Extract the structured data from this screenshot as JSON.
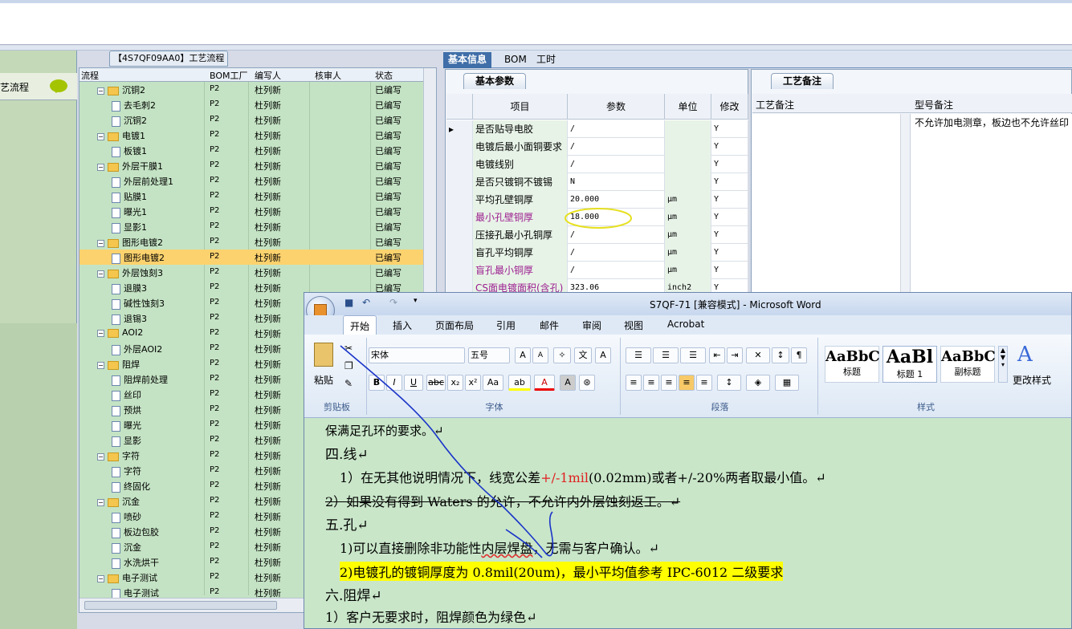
{
  "left_panel": {
    "title": "艺流程"
  },
  "tree": {
    "title": "【4S7QF09AA0】工艺流程",
    "headers": [
      "流程",
      "BOM工厂",
      "编写人",
      "核审人",
      "状态"
    ],
    "rows": [
      {
        "name": "沉铜2",
        "level": 0,
        "folder": true,
        "bom": "P2",
        "author": "杜列新",
        "status": "已编写"
      },
      {
        "name": "去毛刺2",
        "level": 1,
        "folder": false,
        "bom": "P2",
        "author": "杜列新",
        "status": "已编写"
      },
      {
        "name": "沉铜2",
        "level": 1,
        "folder": false,
        "bom": "P2",
        "author": "杜列新",
        "status": "已编写"
      },
      {
        "name": "电镀1",
        "level": 0,
        "folder": true,
        "bom": "P2",
        "author": "杜列新",
        "status": "已编写"
      },
      {
        "name": "板镀1",
        "level": 1,
        "folder": false,
        "bom": "P2",
        "author": "杜列新",
        "status": "已编写"
      },
      {
        "name": "外层干膜1",
        "level": 0,
        "folder": true,
        "bom": "P2",
        "author": "杜列新",
        "status": "已编写"
      },
      {
        "name": "外层前处理1",
        "level": 1,
        "folder": false,
        "bom": "P2",
        "author": "杜列新",
        "status": "已编写"
      },
      {
        "name": "贴膜1",
        "level": 1,
        "folder": false,
        "bom": "P2",
        "author": "杜列新",
        "status": "已编写"
      },
      {
        "name": "曝光1",
        "level": 1,
        "folder": false,
        "bom": "P2",
        "author": "杜列新",
        "status": "已编写"
      },
      {
        "name": "显影1",
        "level": 1,
        "folder": false,
        "bom": "P2",
        "author": "杜列新",
        "status": "已编写"
      },
      {
        "name": "图形电镀2",
        "level": 0,
        "folder": true,
        "bom": "P2",
        "author": "杜列新",
        "status": "已编写"
      },
      {
        "name": "图形电镀2",
        "level": 1,
        "folder": false,
        "bom": "P2",
        "author": "杜列新",
        "status": "已编写",
        "selected": true
      },
      {
        "name": "外层蚀刻3",
        "level": 0,
        "folder": true,
        "bom": "P2",
        "author": "杜列新",
        "status": "已编写"
      },
      {
        "name": "退膜3",
        "level": 1,
        "folder": false,
        "bom": "P2",
        "author": "杜列新",
        "status": "已编写"
      },
      {
        "name": "碱性蚀刻3",
        "level": 1,
        "folder": false,
        "bom": "P2",
        "author": "杜列新",
        "status": "已编写"
      },
      {
        "name": "退锡3",
        "level": 1,
        "folder": false,
        "bom": "P2",
        "author": "杜列新",
        "status": "已编写"
      },
      {
        "name": "AOI2",
        "level": 0,
        "folder": true,
        "bom": "P2",
        "author": "杜列新",
        "status": "已编写"
      },
      {
        "name": "外层AOI2",
        "level": 1,
        "folder": false,
        "bom": "P2",
        "author": "杜列新",
        "status": "已编写"
      },
      {
        "name": "阻焊",
        "level": 0,
        "folder": true,
        "bom": "P2",
        "author": "杜列新",
        "status": "已编写"
      },
      {
        "name": "阻焊前处理",
        "level": 1,
        "folder": false,
        "bom": "P2",
        "author": "杜列新",
        "status": "已编写"
      },
      {
        "name": "丝印",
        "level": 1,
        "folder": false,
        "bom": "P2",
        "author": "杜列新",
        "status": "已编写"
      },
      {
        "name": "预烘",
        "level": 1,
        "folder": false,
        "bom": "P2",
        "author": "杜列新",
        "status": "已编写"
      },
      {
        "name": "曝光",
        "level": 1,
        "folder": false,
        "bom": "P2",
        "author": "杜列新",
        "status": "已编写"
      },
      {
        "name": "显影",
        "level": 1,
        "folder": false,
        "bom": "P2",
        "author": "杜列新",
        "status": "已编写"
      },
      {
        "name": "字符",
        "level": 0,
        "folder": true,
        "bom": "P2",
        "author": "杜列新",
        "status": "已编写"
      },
      {
        "name": "字符",
        "level": 1,
        "folder": false,
        "bom": "P2",
        "author": "杜列新",
        "status": "已编写"
      },
      {
        "name": "终固化",
        "level": 1,
        "folder": false,
        "bom": "P2",
        "author": "杜列新",
        "status": "已编写"
      },
      {
        "name": "沉金",
        "level": 0,
        "folder": true,
        "bom": "P2",
        "author": "杜列新",
        "status": "已编写"
      },
      {
        "name": "喷砂",
        "level": 1,
        "folder": false,
        "bom": "P2",
        "author": "杜列新",
        "status": "已编写"
      },
      {
        "name": "板边包胶",
        "level": 1,
        "folder": false,
        "bom": "P2",
        "author": "杜列新",
        "status": "已编写"
      },
      {
        "name": "沉金",
        "level": 1,
        "folder": false,
        "bom": "P2",
        "author": "杜列新",
        "status": "已编写"
      },
      {
        "name": "水洗烘干",
        "level": 1,
        "folder": false,
        "bom": "P2",
        "author": "杜列新",
        "status": "已编写"
      },
      {
        "name": "电子测试",
        "level": 0,
        "folder": true,
        "bom": "P2",
        "author": "杜列新",
        "status": "已编写"
      },
      {
        "name": "电子测试",
        "level": 1,
        "folder": false,
        "bom": "P2",
        "author": "杜列新",
        "status": "已编写"
      }
    ]
  },
  "right_tabs": [
    "基本信息",
    "BOM",
    "工时"
  ],
  "basic": {
    "subtab": "基本参数",
    "headers": [
      "项目",
      "参数",
      "单位",
      "修改"
    ],
    "rows": [
      {
        "item": "是否贴导电胶",
        "param": "/",
        "unit": "",
        "mod": "Y",
        "color": "normal"
      },
      {
        "item": "电镀后最小面铜要求",
        "param": "/",
        "unit": "",
        "mod": "Y",
        "color": "normal"
      },
      {
        "item": "电镀线别",
        "param": "/",
        "unit": "",
        "mod": "Y",
        "color": "normal"
      },
      {
        "item": "是否只镀铜不镀锡",
        "param": "N",
        "unit": "",
        "mod": "Y",
        "color": "normal"
      },
      {
        "item": "平均孔壁铜厚",
        "param": "20.000",
        "unit": "μm",
        "mod": "Y",
        "color": "normal"
      },
      {
        "item": "最小孔壁铜厚",
        "param": "18.000",
        "unit": "μm",
        "mod": "Y",
        "color": "purple"
      },
      {
        "item": "压接孔最小孔铜厚",
        "param": "/",
        "unit": "μm",
        "mod": "Y",
        "color": "normal"
      },
      {
        "item": "盲孔平均铜厚",
        "param": "/",
        "unit": "μm",
        "mod": "Y",
        "color": "normal"
      },
      {
        "item": "盲孔最小铜厚",
        "param": "/",
        "unit": "μm",
        "mod": "Y",
        "color": "purple"
      },
      {
        "item": "CS面电镀面积(含孔)",
        "param": "323.06",
        "unit": "inch2",
        "mod": "Y",
        "color": "purple"
      }
    ]
  },
  "notes": {
    "tab": "工艺备注",
    "col1": "工艺备注",
    "col2": "型号备注",
    "model_note": "不允许加电测章，板边也不允许丝印"
  },
  "word": {
    "title": "S7QF-71 [兼容模式] - Microsoft Word",
    "tabs": [
      "开始",
      "插入",
      "页面布局",
      "引用",
      "邮件",
      "审阅",
      "视图",
      "Acrobat"
    ],
    "clipboard": {
      "paste": "粘贴",
      "label": "剪贴板"
    },
    "font": {
      "name": "宋体",
      "size": "五号",
      "label": "字体"
    },
    "paragraph_label": "段落",
    "styles": {
      "items": [
        {
          "preview": "AaBbC",
          "name": "标题"
        },
        {
          "preview": "AaBl",
          "name": "标题 1"
        },
        {
          "preview": "AaBbC",
          "name": "副标题"
        }
      ],
      "change": "更改样式",
      "label": "样式"
    },
    "doc": {
      "top": "保满足孔环的要求。↵",
      "h4": "四.线↵",
      "line1_a": "1）在无其他说明情况下，线宽公差",
      "line1_red": "+/-1mil",
      "line1_b": "(0.02mm)或者+/-20%两者取最小值。↵",
      "line2": "2）如果没有得到 Waters 的允许，不允许内外层蚀刻返工。↵",
      "h5": "五.孔↵",
      "line3_a": "1)可以直接删除非功能性",
      "line3_b": "内层焊盘",
      "line3_c": "，无需与客户确认。↵",
      "line4": "2)电镀孔的镀铜厚度为 0.8mil(20um)，最小平均值参考 IPC-6012 二级要求",
      "h6": "六.阻焊↵",
      "line5": "1）客户无要求时，阻焊颜色为绿色↵"
    }
  }
}
